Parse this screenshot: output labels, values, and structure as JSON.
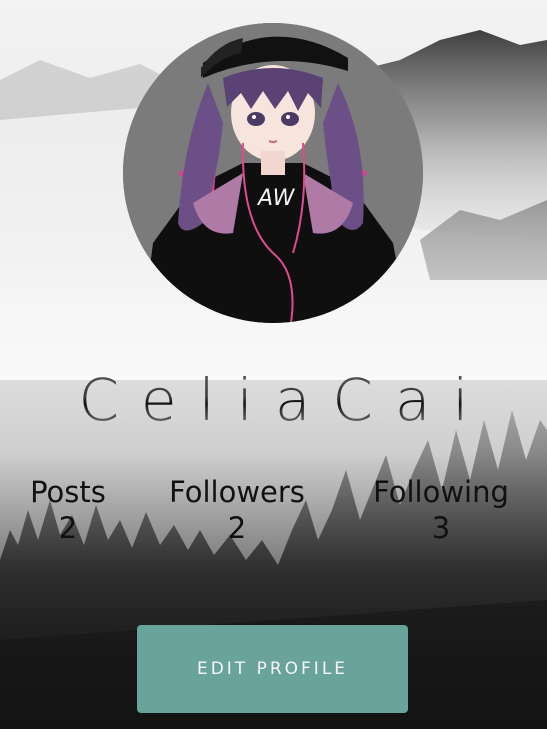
{
  "profile": {
    "name": "CeliaCai",
    "avatar_alt": ""
  },
  "stats": [
    {
      "label": "Posts",
      "value": "2"
    },
    {
      "label": "Followers",
      "value": "2"
    },
    {
      "label": "Following",
      "value": "3"
    }
  ],
  "actions": {
    "edit_profile": "EDIT PROFILE"
  },
  "colors": {
    "button": "#6aa39b",
    "avatar_bg": "#7b7b7b"
  }
}
